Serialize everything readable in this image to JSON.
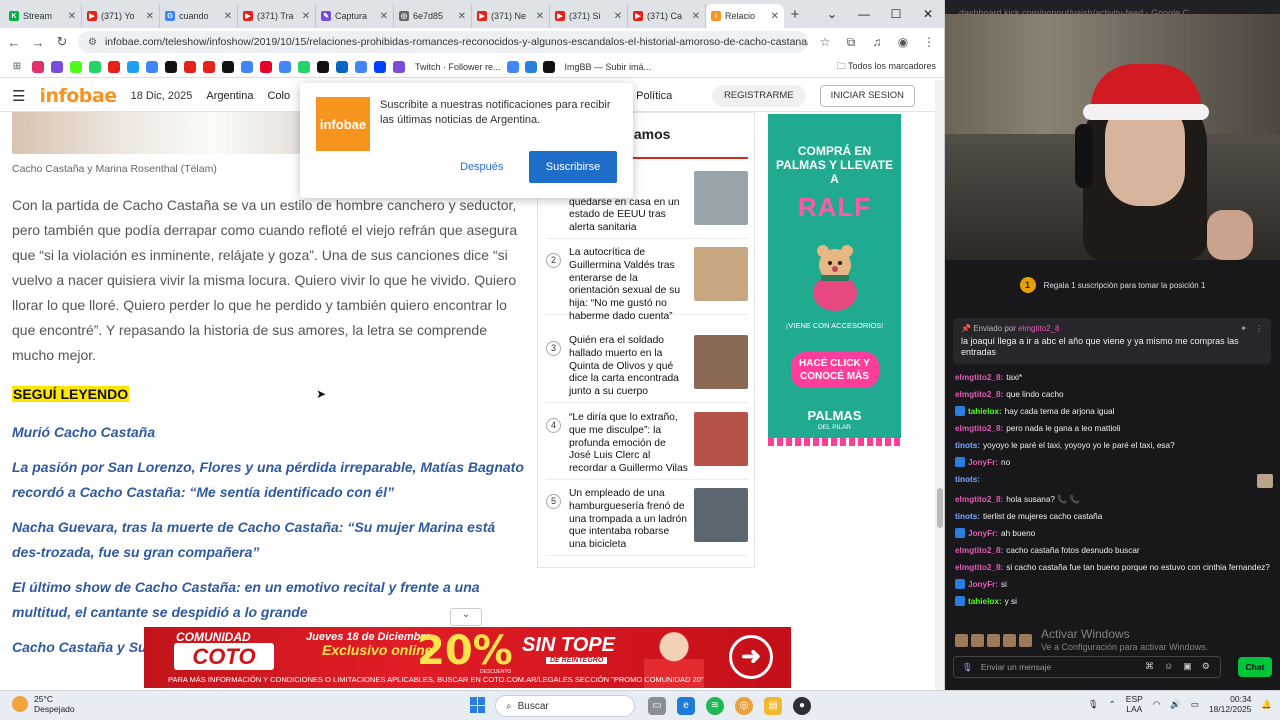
{
  "browser": {
    "tabs": [
      {
        "label": "Stream",
        "color": "#00b140",
        "glyph": "K"
      },
      {
        "label": "(371) Yo",
        "color": "#e62117",
        "glyph": "▶"
      },
      {
        "label": "cuando",
        "color": "#4285f4",
        "glyph": "G"
      },
      {
        "label": "(371) Tra",
        "color": "#e62117",
        "glyph": "▶"
      },
      {
        "label": "Captura",
        "color": "#7b4dd6",
        "glyph": "✎"
      },
      {
        "label": "6e7d85",
        "color": "#666666",
        "glyph": "◎"
      },
      {
        "label": "(371) Ne",
        "color": "#e62117",
        "glyph": "▶"
      },
      {
        "label": "(371) Si",
        "color": "#e62117",
        "glyph": "▶"
      },
      {
        "label": "(371) Ca",
        "color": "#e62117",
        "glyph": "▶"
      },
      {
        "label": "Relacio",
        "color": "#f7941e",
        "glyph": "i"
      }
    ],
    "url": "infobae.com/teleshow/infoshow/2019/10/15/relaciones-prohibidas-romances-reconocidos-y-algunos-escandalos-el-historial-amoroso-de-cacho-castana/",
    "bookmarks_colors": [
      "#e1306c",
      "#7b4dd6",
      "#53fc18",
      "#25d366",
      "#e62117",
      "#1da1f2",
      "#4285f4",
      "#111111",
      "#e62117",
      "#e62117",
      "#111111",
      "#4285f4",
      "#e60023",
      "#4285f4",
      "#25d366",
      "#111111",
      "#0a66c2",
      "#4285f4",
      "#053eff",
      "#7b4dd6"
    ],
    "bookmark_text_1": "Twitch · Follower re...",
    "bookmark_text_2": "ImgBB — Subir imá...",
    "bookmark_folder": "Todos los marcadores"
  },
  "site": {
    "logo": "infobae",
    "date": "18 Dic, 2025",
    "nav": [
      "Argentina",
      "Colo",
      "Política"
    ],
    "register": "REGISTRARME",
    "login": "INICIAR SESION"
  },
  "article": {
    "caption": "Cacho Castaña y Marina Rosenthal (Télam)",
    "body": "Con la partida de Cacho Castaña se va un estilo de hombre canchero y seductor, pero también que podía derrapar como cuando refloté el viejo refrán que asegura que “si la violación es inminente, relájate y goza”. Una de sus canciones dice “si vuelvo a nacer quisiera vivir la misma locura. Quiero vivir lo que he vivido. Quiero llorar lo que lloré. Quiero perder lo que he perdido y también quiero encontrar lo que encontré”. Y repasando la historia de sus amores, la letra se comprende mucho mejor.",
    "keep_reading": "SEGUÍ LEYENDO",
    "related": [
      "Murió Cacho Castaña",
      "La pasión por San Lorenzo, Flores y una pérdida irreparable, Matías Bagnato recordó a Cacho Castaña: “Me sentía identificado con él”",
      "Nacha Guevara, tras la muerte de Cacho Castaña: “Su mujer Marina está des-trozada, fue su gran compañera”",
      "El último show de Cacho Castaña: en un emotivo recital y frente a una multitud, el cantante se despidió a lo grande",
      "Cacho Castaña y Sus"
    ]
  },
  "sidebar": {
    "title": "lamos",
    "items": [
      {
        "num": "",
        "text": "nas\nertencia de\nquedarse en casa en un\nestado de EEUU tras\nalerta sanitaria",
        "thumb": "#9aa4ab"
      },
      {
        "num": "2",
        "text": "La autocrítica de Guillermina Valdés tras enterarse de la orientación sexual de su hija: “No me gustó no haberme dado cuenta”",
        "thumb": "#c7a882"
      },
      {
        "num": "3",
        "text": "Quién era el soldado hallado muerto en la Quinta de Olivos y qué dice la carta encontrada junto a su cuerpo",
        "thumb": "#8a6a55"
      },
      {
        "num": "4",
        "text": "“Le diría que lo extraño, que me disculpe”: la profunda emoción de José Luis Clerc al recordar a Guillermo Vilas",
        "thumb": "#b5524a"
      },
      {
        "num": "5",
        "text": "Un empleado de una hamburguesería frenó de una trompada a un ladrón que intentaba robarse una bicicleta",
        "thumb": "#5b6670"
      }
    ]
  },
  "ad": {
    "top": "COMPRÁ EN PALMAS Y LLEVATE A",
    "brand": "RALF",
    "sub": "¡VIENE CON ACCESORIOS!",
    "cta": "HACÉ CLICK Y CONOCÉ MÁS",
    "logo": "PALMAS",
    "logo_sub": "DEL PILAR"
  },
  "popup": {
    "logo": "infobae",
    "message": "Suscribite a nuestras notificaciones para recibir las últimas noticias de Argentina.",
    "later": "Después",
    "subscribe": "Suscribirse"
  },
  "banner": {
    "comunidad": "COMUNIDAD",
    "coto": "COTO",
    "date": "Jueves 18 de Diciembre",
    "exclusivo": "Exclusivo online",
    "percent": "20%",
    "descuento": "DESCUENTO",
    "tope": "SIN TOPE",
    "reintegro": "DE REINTEGRO",
    "fine": "PARA MÁS INFORMACIÓN Y CONDICIONES O LIMITACIONES APLICABLES, BUSCAR EN COTO.COM.AR/LEGALES SECCIÓN \"PROMO COMUNIDAD 20\"",
    "arrow": "➜"
  },
  "chat": {
    "url": "dashboard.kick.com/popout/vaish/activity-feed - Google C",
    "sub_banner": "Regala 1 suscripción para tomar la posición 1",
    "sub_badge": "1",
    "pinned": {
      "prefix": "Enviado por",
      "user": "elmgtito2_8",
      "text": "la joaquí llega a ir a abc el año que viene y ya mismo me compras las entradas"
    },
    "messages": [
      {
        "user": "elmgtito2_8:",
        "color": "#e05cb5",
        "text": "taxi*",
        "badge": ""
      },
      {
        "user": "elmgtito2_8:",
        "color": "#e05cb5",
        "text": "que lindo cacho",
        "badge": ""
      },
      {
        "user": "tahielox:",
        "color": "#53fc18",
        "text": "hay cada tema de arjona igual",
        "badge": "#2a7de1"
      },
      {
        "user": "elmgtito2_8:",
        "color": "#e05cb5",
        "text": "pero nada le gana a leo mattioli",
        "badge": ""
      },
      {
        "user": "tinots:",
        "color": "#7aa7ff",
        "text": "yoyoyo le paré el taxi, yoyoyo yo le paré el taxi, esa?",
        "badge": ""
      },
      {
        "user": "JonyFr:",
        "color": "#e05cb5",
        "text": "no",
        "badge": "#2a7de1"
      },
      {
        "user": "tinots:",
        "color": "#7aa7ff",
        "text": "",
        "badge": ""
      },
      {
        "user": "elmgtito2_8:",
        "color": "#e05cb5",
        "text": "hola susana? 📞 📞",
        "badge": ""
      },
      {
        "user": "tinots:",
        "color": "#7aa7ff",
        "text": "tierlist de mujeres cacho castaña",
        "badge": ""
      },
      {
        "user": "JonyFr:",
        "color": "#e05cb5",
        "text": "ah bueno",
        "badge": "#2a7de1"
      },
      {
        "user": "elmgtito2_8:",
        "color": "#e05cb5",
        "text": "cacho castaña fotos desnudo buscar",
        "badge": ""
      },
      {
        "user": "elmgtito2_8:",
        "color": "#e05cb5",
        "text": "si cacho castaña fue tan bueno porque no estuvo con cinthia fernandez?",
        "badge": ""
      },
      {
        "user": "JonyFr:",
        "color": "#e05cb5",
        "text": "si",
        "badge": "#2a7de1"
      },
      {
        "user": "tahielox:",
        "color": "#53fc18",
        "text": "y si",
        "badge": "#2a7de1"
      }
    ],
    "activate_title": "Activar Windows",
    "activate_sub": "Ve a Configuración para activar Windows.",
    "input_placeholder": "Enviar un mensaje",
    "send": "Chat"
  },
  "taskbar": {
    "temp": "25°C",
    "weather": "Despejado",
    "search": "Buscar",
    "lang1": "ESP",
    "lang2": "LAA",
    "time": "00:34",
    "date": "18/12/2025"
  }
}
